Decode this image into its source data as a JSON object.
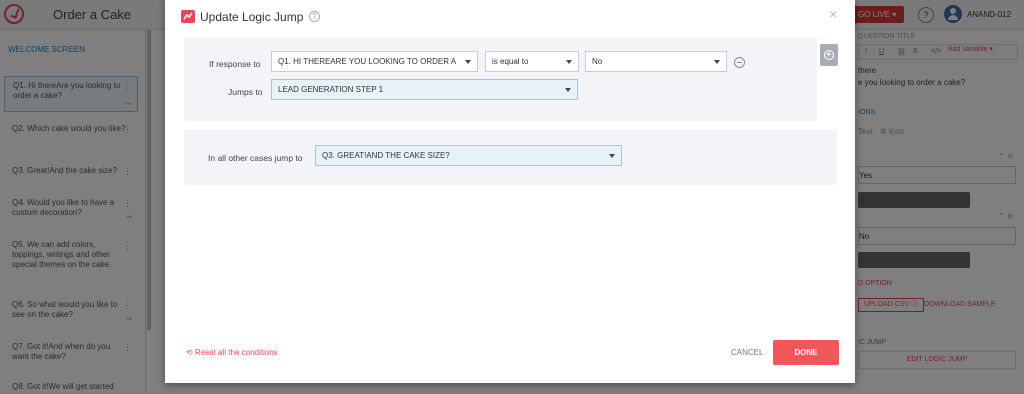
{
  "app": {
    "title": "Order a Cake",
    "go_live_label": "GO LIVE ▾",
    "help_glyph": "?",
    "user_name": "ANAND-012"
  },
  "sidebar": {
    "welcome": "WELCOME SCREEN",
    "items": [
      {
        "label": "Q1. Hi thereAre you looking to order a cake?"
      },
      {
        "label": "Q2. Which cake would you like?"
      },
      {
        "label": "Q3. Great!And the cake size?"
      },
      {
        "label": "Q4. Would you like to have a custom decoration?"
      },
      {
        "label": "Q5. We can add colors, toppings, writings and other special themes on the cake."
      },
      {
        "label": "Q6. So what would you like to see on the cake?"
      },
      {
        "label": "Q7. Got it!And when do you want the cake?"
      },
      {
        "label": "Q8. Got it!We will get started"
      }
    ]
  },
  "right_panel": {
    "question_title_label": "QUESTION TITLE",
    "add_variable": "Add Variable ▾",
    "question_text_1": "there",
    "question_text_2": "e you looking to order a cake?",
    "options_label": "IONS",
    "text_option": "Text",
    "icon_option": "Icon",
    "answer_1": "Yes",
    "answer_2": "No",
    "add_option": "D OPTION",
    "upload_csv": "UPLOAD CSV ⓘ",
    "download_sample": "DOWNLOAD SAMPLE",
    "logic_jump_label": "IC JUMP",
    "edit_logic_jump": "EDIT LOGIC JUMP"
  },
  "modal": {
    "title": "Update Logic Jump",
    "close_glyph": "×",
    "add_glyph": "+",
    "condition": {
      "if_response_label": "If response to",
      "question_value": "Q1. HI THEREARE YOU LOOKING TO ORDER A CAKE?",
      "operator_value": "is equal to",
      "answer_value": "No",
      "jumps_to_label": "Jumps to",
      "jump_target_value": "LEAD GENERATION STEP 1"
    },
    "else": {
      "label": "In all other cases jump to",
      "target_value": "Q3. GREAT!AND THE CAKE SIZE?"
    },
    "reset_label": "⟲ Reset all the conditions",
    "cancel_label": "CANCEL",
    "done_label": "DONE"
  }
}
